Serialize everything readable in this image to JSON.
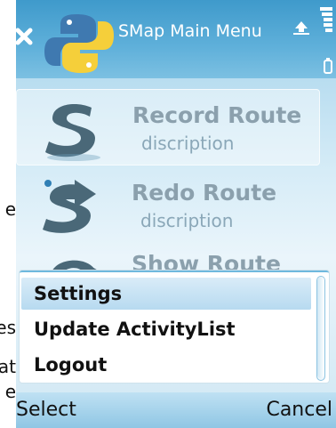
{
  "title_bar": {
    "title": "SMap Main Menu"
  },
  "menu_items": [
    {
      "label": "Record Route",
      "description": "discription"
    },
    {
      "label": "Redo Route",
      "description": "discription"
    },
    {
      "label": "Show Route"
    }
  ],
  "popup": {
    "items": [
      "Settings",
      "Update ActivityList",
      "Logout"
    ],
    "highlighted": "Settings"
  },
  "softkeys": {
    "left": "Select",
    "right": "Cancel"
  },
  "background_text_fragments": [
    "e",
    "es",
    "at",
    "e"
  ],
  "colors": {
    "title_bar": "#5fb0da",
    "highlight": "#b7daf0",
    "popup_border": "#6fb9de"
  }
}
